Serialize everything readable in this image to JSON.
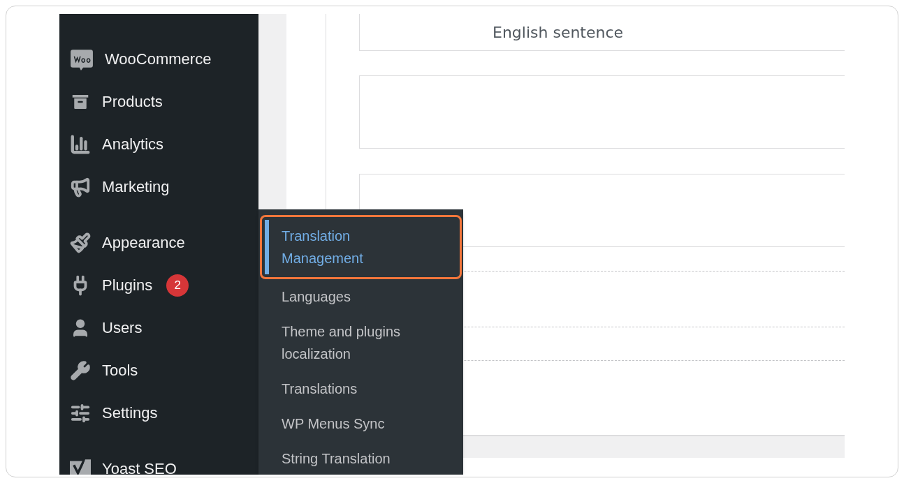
{
  "content": {
    "sentence": "English sentence"
  },
  "sidebar": {
    "groups": [
      [
        {
          "label": "WooCommerce",
          "kind": "woo"
        },
        {
          "label": "Products",
          "kind": "products"
        },
        {
          "label": "Analytics",
          "kind": "analytics"
        },
        {
          "label": "Marketing",
          "kind": "marketing"
        }
      ],
      [
        {
          "label": "Appearance",
          "kind": "appearance"
        },
        {
          "label": "Plugins",
          "kind": "plugins",
          "badge": "2"
        },
        {
          "label": "Users",
          "kind": "users"
        },
        {
          "label": "Tools",
          "kind": "tools"
        },
        {
          "label": "Settings",
          "kind": "settings"
        }
      ],
      [
        {
          "label": "Yoast SEO",
          "kind": "yoast"
        }
      ]
    ]
  },
  "submenu": {
    "items": [
      {
        "label": "Translation Management",
        "selected": true
      },
      {
        "label": "Languages",
        "selected": false
      },
      {
        "label": "Theme and plugins localization",
        "selected": false
      },
      {
        "label": "Translations",
        "selected": false
      },
      {
        "label": "WP Menus Sync",
        "selected": false
      },
      {
        "label": "String Translation",
        "selected": false
      }
    ]
  }
}
